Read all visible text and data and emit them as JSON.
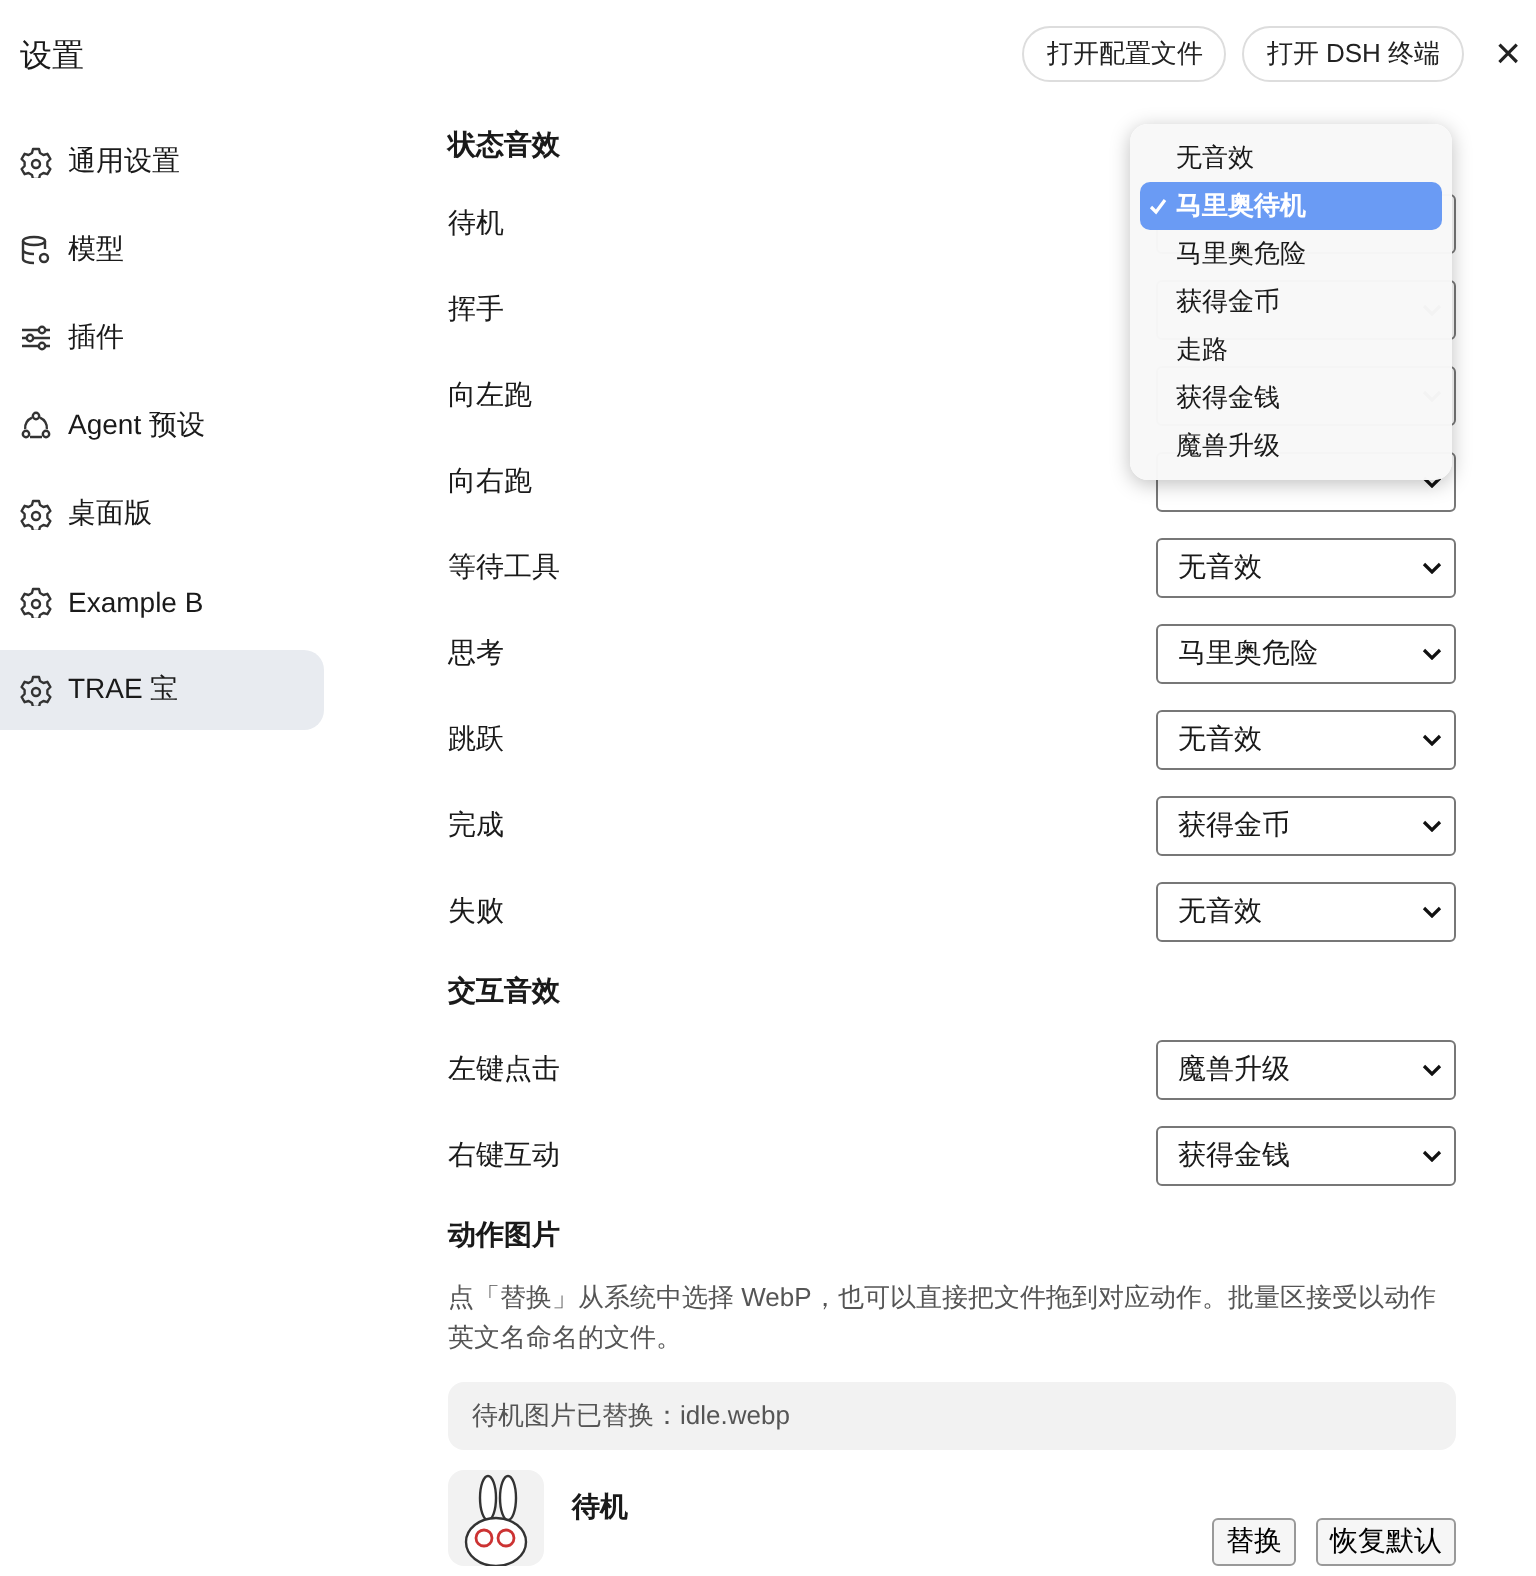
{
  "header": {
    "title": "设置",
    "buttons": [
      "打开配置文件",
      "打开 DSH 终端"
    ],
    "close": "×"
  },
  "sidebar": {
    "items": [
      {
        "label": "通用设置",
        "kind": "gear",
        "selected": false
      },
      {
        "label": "模型",
        "kind": "database",
        "selected": false
      },
      {
        "label": "插件",
        "kind": "sliders",
        "selected": false
      },
      {
        "label": "Agent 预设",
        "kind": "agent",
        "selected": false
      },
      {
        "label": "桌面版",
        "kind": "gear",
        "selected": false
      },
      {
        "label": "Example B",
        "kind": "gear",
        "selected": false
      },
      {
        "label": "TRAE 宝",
        "kind": "gear",
        "selected": true
      }
    ]
  },
  "sections": [
    {
      "title": "状态音效",
      "rows": [
        {
          "label": "待机",
          "menu": {
            "options": [
              {
                "label": "无音效",
                "selected": false
              },
              {
                "label": "马里奥待机",
                "selected": true
              },
              {
                "label": "马里奥危险",
                "selected": false
              },
              {
                "label": "获得金币",
                "selected": false
              },
              {
                "label": "走路",
                "selected": false
              },
              {
                "label": "获得金钱",
                "selected": false
              },
              {
                "label": "魔兽升级",
                "selected": false
              }
            ]
          }
        },
        {
          "label": "挥手"
        },
        {
          "label": "向左跑"
        },
        {
          "label": "向右跑"
        },
        {
          "label": "等待工具",
          "value": "无音效"
        },
        {
          "label": "思考",
          "value": "马里奥危险"
        },
        {
          "label": "跳跃",
          "value": "无音效"
        },
        {
          "label": "完成",
          "value": "获得金币"
        },
        {
          "label": "失败",
          "value": "无音效"
        }
      ]
    },
    {
      "title": "交互音效",
      "rows": [
        {
          "label": "左键点击",
          "value": "魔兽升级"
        },
        {
          "label": "右键互动",
          "value": "获得金钱"
        }
      ]
    }
  ],
  "images": {
    "title": "动作图片",
    "hint": "点「替换」从系统中选择 WebP，也可以直接把文件拖到对应动作。批量区接受以动作英文名命名的文件。",
    "notice": "待机图片已替换：idle.webp",
    "items": [
      {
        "name": "待机",
        "buttons": [
          "替换",
          "恢复默认"
        ]
      }
    ]
  }
}
